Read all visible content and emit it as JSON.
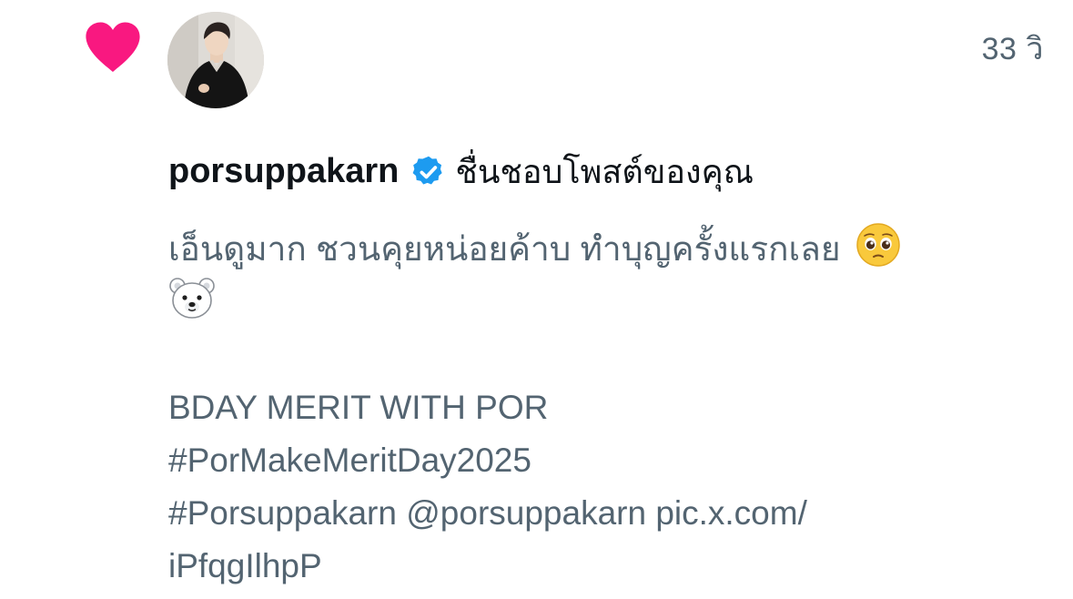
{
  "notification": {
    "icon": "heart-icon",
    "icon_color": "#f91880",
    "timestamp": "33 วิ",
    "liker": {
      "name": "porsuppakarn",
      "verified": true,
      "verified_color": "#1d9bf0",
      "action": "ชื่นชอบโพสต์ของคุณ"
    },
    "post": {
      "line1": "เอ็นดูมาก ชวนคุยหน่อยค้าบ ทำบุญครั้งแรกเลย",
      "line1_emoji": "pleading-face-icon",
      "line2_emoji": "polar-bear-icon",
      "line3": "BDAY MERIT WITH POR",
      "line4": "#PorMakeMeritDay2025",
      "line5": "#Porsuppakarn @porsuppakarn pic.x.com/",
      "line6": "iPfqgIlhpP",
      "text_color": "#536471"
    }
  }
}
